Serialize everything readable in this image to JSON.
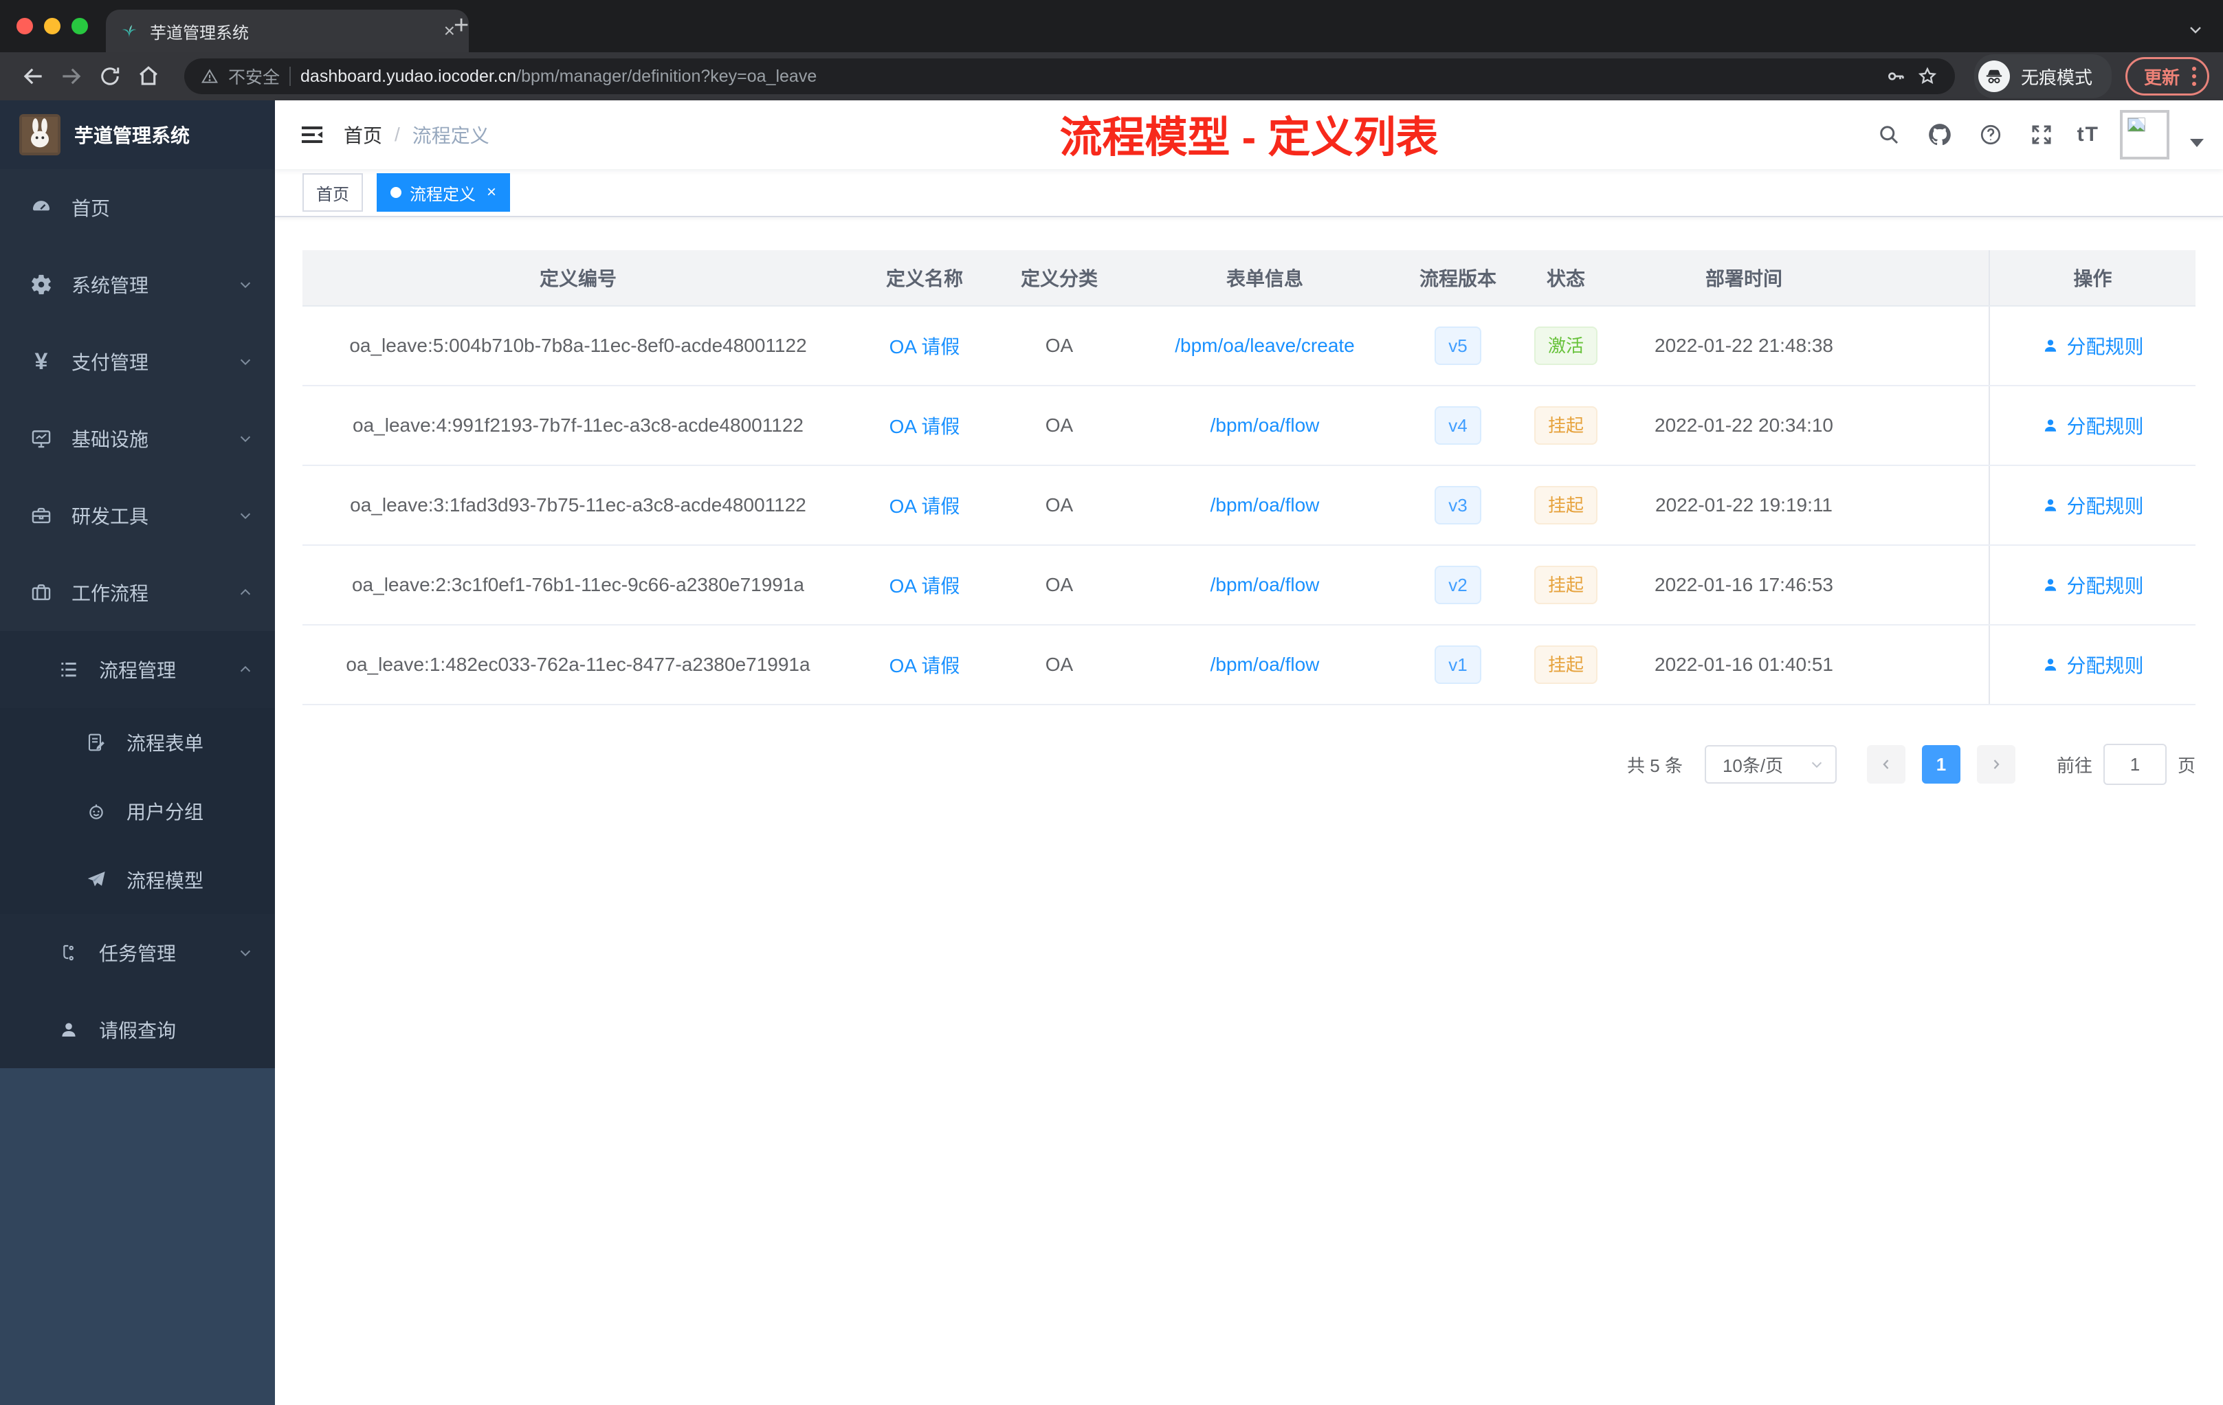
{
  "browser": {
    "tab": {
      "title": "芋道管理系统",
      "close": "×",
      "new_tab": "+"
    },
    "address": {
      "security": "不安全",
      "domain": "dashboard.yudao.iocoder.cn",
      "path": "/bpm/manager/definition?key=oa_leave"
    },
    "incognito_label": "无痕模式",
    "update_label": "更新"
  },
  "sidebar": {
    "title": "芋道管理系统",
    "menu": [
      {
        "label": "首页"
      },
      {
        "label": "系统管理"
      },
      {
        "label": "支付管理"
      },
      {
        "label": "基础设施"
      },
      {
        "label": "研发工具"
      },
      {
        "label": "工作流程"
      },
      {
        "label": "流程管理"
      },
      {
        "label": "流程表单"
      },
      {
        "label": "用户分组"
      },
      {
        "label": "流程模型"
      },
      {
        "label": "任务管理"
      },
      {
        "label": "请假查询"
      }
    ]
  },
  "header": {
    "breadcrumb": {
      "home": "首页",
      "sep": "/",
      "current": "流程定义"
    },
    "annotation": "流程模型 - 定义列表",
    "font_icon": "tT"
  },
  "tags": {
    "home": "首页",
    "current": "流程定义",
    "close": "×"
  },
  "table": {
    "columns": {
      "id": "定义编号",
      "name": "定义名称",
      "category": "定义分类",
      "form": "表单信息",
      "version": "流程版本",
      "status": "状态",
      "deploy_time": "部署时间",
      "action": "操作"
    },
    "rows": [
      {
        "id": "oa_leave:5:004b710b-7b8a-11ec-8ef0-acde48001122",
        "name": "OA 请假",
        "category": "OA",
        "form": "/bpm/oa/leave/create",
        "version": "v5",
        "status": "激活",
        "status_type": "success",
        "deploy_time": "2022-01-22 21:48:38",
        "action": "分配规则"
      },
      {
        "id": "oa_leave:4:991f2193-7b7f-11ec-a3c8-acde48001122",
        "name": "OA 请假",
        "category": "OA",
        "form": "/bpm/oa/flow",
        "version": "v4",
        "status": "挂起",
        "status_type": "warning",
        "deploy_time": "2022-01-22 20:34:10",
        "action": "分配规则"
      },
      {
        "id": "oa_leave:3:1fad3d93-7b75-11ec-a3c8-acde48001122",
        "name": "OA 请假",
        "category": "OA",
        "form": "/bpm/oa/flow",
        "version": "v3",
        "status": "挂起",
        "status_type": "warning",
        "deploy_time": "2022-01-22 19:19:11",
        "action": "分配规则"
      },
      {
        "id": "oa_leave:2:3c1f0ef1-76b1-11ec-9c66-a2380e71991a",
        "name": "OA 请假",
        "category": "OA",
        "form": "/bpm/oa/flow",
        "version": "v2",
        "status": "挂起",
        "status_type": "warning",
        "deploy_time": "2022-01-16 17:46:53",
        "action": "分配规则"
      },
      {
        "id": "oa_leave:1:482ec033-762a-11ec-8477-a2380e71991a",
        "name": "OA 请假",
        "category": "OA",
        "form": "/bpm/oa/flow",
        "version": "v1",
        "status": "挂起",
        "status_type": "warning",
        "deploy_time": "2022-01-16 01:40:51",
        "action": "分配规则"
      }
    ]
  },
  "pagination": {
    "total": "共 5 条",
    "size": "10条/页",
    "page": "1",
    "goto_label": "前往",
    "goto_value": "1",
    "unit": "页"
  },
  "colors": {
    "link_blue": "#1890ff",
    "accent_blue": "#409eff",
    "annotation_red": "#f7291b",
    "status_green": "#67c23a",
    "status_orange": "#e6a23c",
    "tag_active_bg": "#1890ff",
    "sidebar_menu_bg": "#263140",
    "sidebar_nested_bg": "#212c3b",
    "sidebar_bottom_bg": "#32455c"
  }
}
